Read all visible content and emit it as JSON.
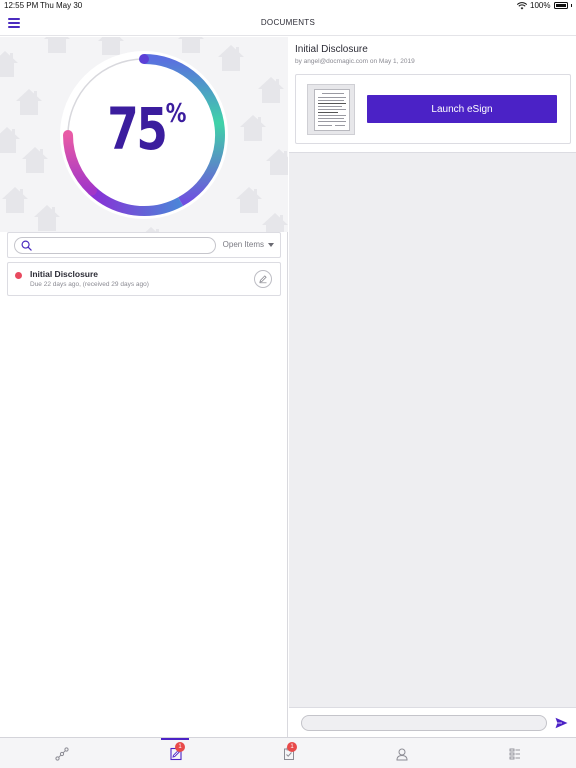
{
  "status_bar": {
    "time": "12:55 PM",
    "date": "Thu May 30",
    "battery": "100%"
  },
  "header": {
    "title": "DOCUMENTS"
  },
  "progress": {
    "value": 0.75,
    "number": "75",
    "unit": "%"
  },
  "search": {
    "placeholder": "",
    "value": "",
    "filter_label": "Open Items"
  },
  "documents": [
    {
      "title": "Initial Disclosure",
      "subtitle": "Due 22 days ago, (received 29 days ago)",
      "status_color": "#e84a5f"
    }
  ],
  "detail": {
    "title": "Initial Disclosure",
    "byline": "by angel@docmagic.com on May 1, 2019",
    "action_label": "Launch eSign"
  },
  "message": {
    "placeholder": "",
    "value": ""
  },
  "tabs": [
    {
      "name": "timeline",
      "icon": "timeline-icon",
      "badge": ""
    },
    {
      "name": "documents",
      "icon": "documents-icon",
      "badge": "1",
      "active": true
    },
    {
      "name": "tasks",
      "icon": "tasks-icon",
      "badge": "1"
    },
    {
      "name": "contacts",
      "icon": "contact-icon",
      "badge": ""
    },
    {
      "name": "details",
      "icon": "details-icon",
      "badge": ""
    }
  ],
  "colors": {
    "accent": "#4b22c6",
    "alert": "#e84a5f",
    "ring_start": "#4fd1a5",
    "ring_mid": "#7b3fe4",
    "ring_end": "#e45aa8"
  }
}
